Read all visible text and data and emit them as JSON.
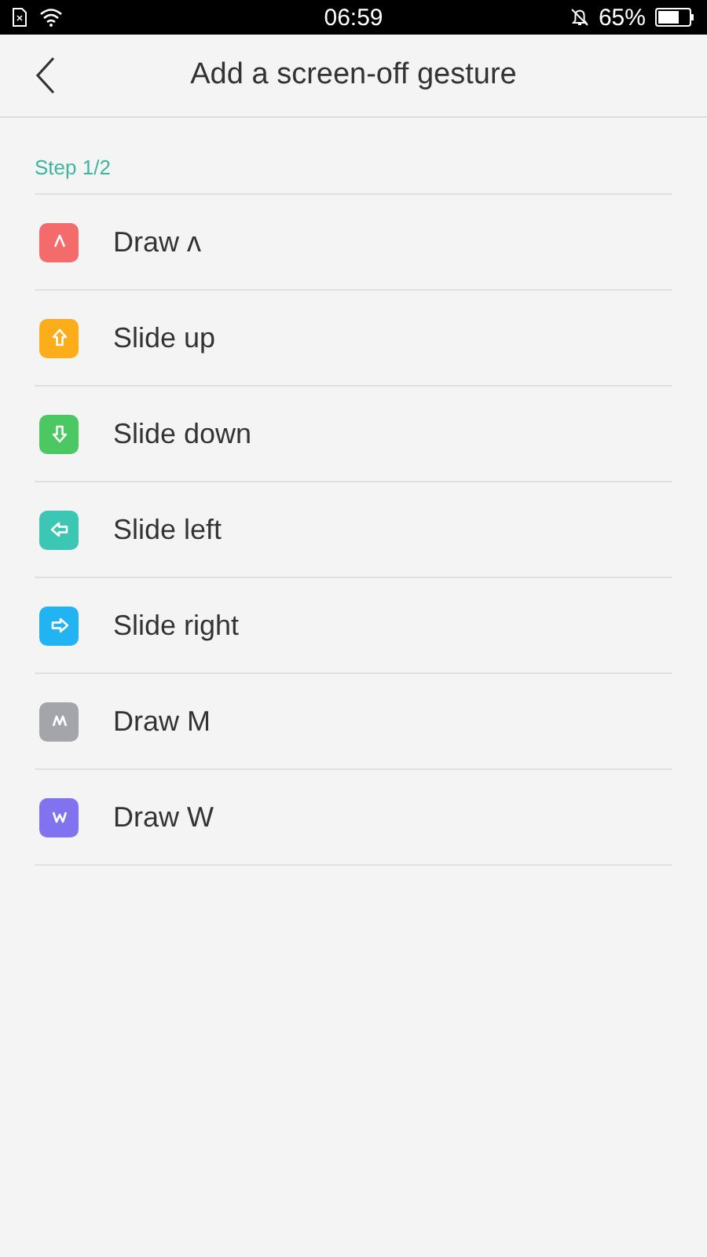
{
  "status_bar": {
    "time": "06:59",
    "battery": "65%"
  },
  "header": {
    "title": "Add a screen-off gesture"
  },
  "step": "Step 1/2",
  "gestures": [
    {
      "label": "Draw ʌ",
      "kind": "caret",
      "color": "#f46b6b"
    },
    {
      "label": "Slide up",
      "kind": "up",
      "color": "#fbad1a"
    },
    {
      "label": "Slide down",
      "kind": "down",
      "color": "#4cc862"
    },
    {
      "label": "Slide left",
      "kind": "left",
      "color": "#3cc7b4"
    },
    {
      "label": "Slide right",
      "kind": "right",
      "color": "#21b3f2"
    },
    {
      "label": "Draw M",
      "kind": "m",
      "color": "#a3a5aa"
    },
    {
      "label": "Draw W",
      "kind": "w",
      "color": "#8172f0"
    }
  ]
}
